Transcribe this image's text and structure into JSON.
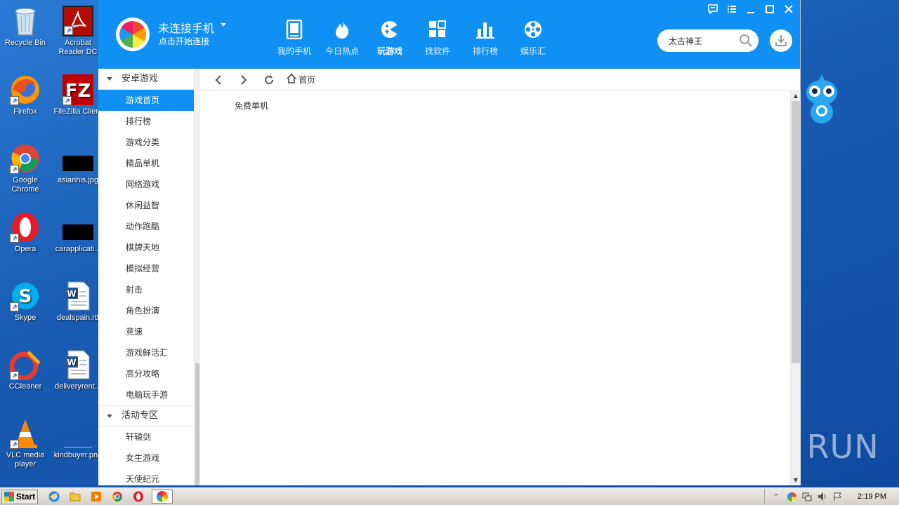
{
  "desktop": {
    "icons": [
      {
        "label": "Recycle Bin"
      },
      {
        "label": "Acrobat Reader DC"
      },
      {
        "label": "Firefox"
      },
      {
        "label": "FileZilla Client"
      },
      {
        "label": "Google Chrome"
      },
      {
        "label": "asianhis.jpg"
      },
      {
        "label": "Opera"
      },
      {
        "label": "carapplicati..."
      },
      {
        "label": "Skype"
      },
      {
        "label": "dealspain.rtf"
      },
      {
        "label": "CCleaner"
      },
      {
        "label": "deliveryrent..."
      },
      {
        "label": "VLC media player"
      },
      {
        "label": "kindbuyer.png"
      }
    ],
    "watermark": "ANY RUN"
  },
  "app": {
    "connection": {
      "title": "未连接手机",
      "subtitle": "点击开始连接"
    },
    "nav": [
      {
        "label": "我的手机",
        "icon": "phone-icon"
      },
      {
        "label": "今日热点",
        "icon": "flame-icon"
      },
      {
        "label": "玩游戏",
        "icon": "gamepad-icon",
        "active": true
      },
      {
        "label": "找软件",
        "icon": "apps-icon"
      },
      {
        "label": "排行榜",
        "icon": "bar-chart-icon"
      },
      {
        "label": "娱乐汇",
        "icon": "film-reel-icon"
      }
    ],
    "search": {
      "value": "太古神王"
    },
    "sidebar": {
      "groups": [
        {
          "title": "安卓游戏",
          "items": [
            "游戏首页",
            "排行榜",
            "游戏分类",
            "精品单机",
            "网络游戏",
            "休闲益智",
            "动作跑酷",
            "棋牌天地",
            "模拟经营",
            "射击",
            "角色扮演",
            "竞速",
            "游戏鲜活汇",
            "高分攻略",
            "电脑玩手游"
          ]
        },
        {
          "title": "活动专区",
          "items": [
            "轩辕剑",
            "女生游戏",
            "天使纪元"
          ]
        }
      ],
      "active_item": "游戏首页"
    },
    "content": {
      "breadcrumb": "首页",
      "free_label": "免费单机"
    },
    "colors": {
      "brand": "#0f90f2",
      "active_bg": "#0f90f2"
    }
  },
  "taskbar": {
    "start_label": "Start",
    "clock": "2:19 PM"
  }
}
